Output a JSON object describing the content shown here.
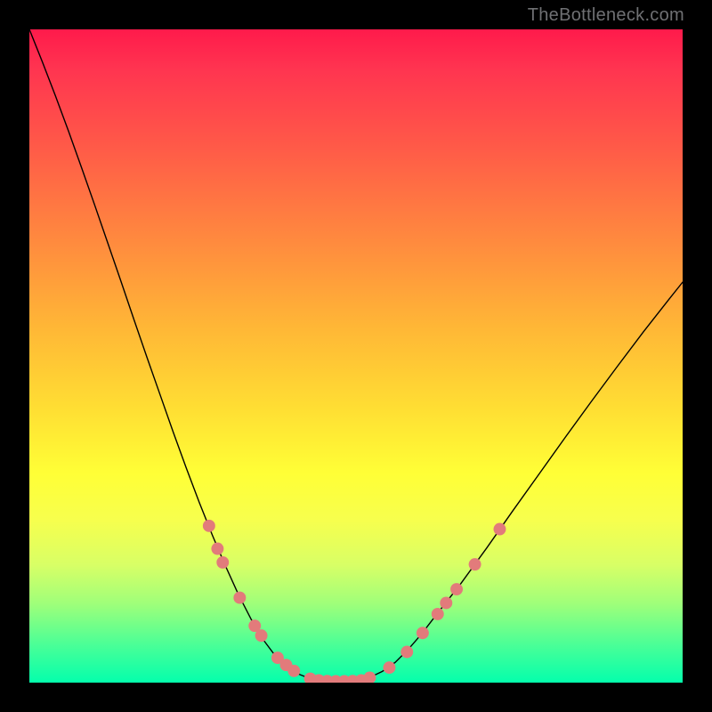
{
  "watermark": {
    "text": "TheBottleneck.com"
  },
  "chart_data": {
    "type": "line",
    "title": "",
    "xlabel": "",
    "ylabel": "",
    "xlim": [
      0,
      100
    ],
    "ylim": [
      0,
      100
    ],
    "grid": false,
    "series": [
      {
        "name": "curve-left",
        "stroke": "#000000",
        "stroke_width": 1.4,
        "x": [
          0,
          2,
          4,
          6,
          8,
          10,
          12,
          14,
          16,
          18,
          20,
          22,
          24,
          26,
          28,
          30,
          32,
          34,
          36,
          37.5,
          39,
          41,
          43
        ],
        "y": [
          100,
          95,
          89.8,
          84.4,
          78.8,
          73.1,
          67.3,
          61.5,
          55.6,
          49.8,
          44.1,
          38.4,
          32.9,
          27.6,
          22.6,
          17.9,
          13.5,
          9.6,
          6.3,
          4.3,
          2.9,
          1.4,
          0.6
        ]
      },
      {
        "name": "curve-flat",
        "stroke": "#000000",
        "stroke_width": 1.4,
        "x": [
          43,
          44,
          45,
          46,
          47,
          48,
          49,
          50,
          51,
          52
        ],
        "y": [
          0.6,
          0.35,
          0.25,
          0.2,
          0.2,
          0.2,
          0.25,
          0.35,
          0.5,
          0.75
        ]
      },
      {
        "name": "curve-right",
        "stroke": "#000000",
        "stroke_width": 1.4,
        "x": [
          52,
          54,
          56,
          58,
          60,
          62,
          66,
          70,
          74,
          78,
          82,
          86,
          90,
          94,
          98,
          100
        ],
        "y": [
          0.75,
          1.7,
          3.1,
          5.1,
          7.4,
          10.0,
          15.1,
          20.6,
          26.3,
          31.9,
          37.5,
          43.0,
          48.4,
          53.7,
          58.8,
          61.3
        ]
      }
    ],
    "markers": [
      {
        "cx": 27.5,
        "cy": 24.0,
        "r": 0.95,
        "fill": "#e27b7b"
      },
      {
        "cx": 28.8,
        "cy": 20.5,
        "r": 0.95,
        "fill": "#e27b7b"
      },
      {
        "cx": 29.6,
        "cy": 18.4,
        "r": 0.95,
        "fill": "#e27b7b"
      },
      {
        "cx": 32.2,
        "cy": 13.0,
        "r": 0.95,
        "fill": "#e27b7b"
      },
      {
        "cx": 34.5,
        "cy": 8.7,
        "r": 0.95,
        "fill": "#e27b7b"
      },
      {
        "cx": 35.5,
        "cy": 7.2,
        "r": 0.95,
        "fill": "#e27b7b"
      },
      {
        "cx": 38.0,
        "cy": 3.8,
        "r": 0.95,
        "fill": "#e27b7b"
      },
      {
        "cx": 39.3,
        "cy": 2.7,
        "r": 0.95,
        "fill": "#e27b7b"
      },
      {
        "cx": 40.5,
        "cy": 1.8,
        "r": 0.95,
        "fill": "#e27b7b"
      },
      {
        "cx": 43.0,
        "cy": 0.6,
        "r": 0.95,
        "fill": "#e27b7b"
      },
      {
        "cx": 44.3,
        "cy": 0.35,
        "r": 0.95,
        "fill": "#e27b7b"
      },
      {
        "cx": 45.6,
        "cy": 0.25,
        "r": 0.95,
        "fill": "#e27b7b"
      },
      {
        "cx": 46.9,
        "cy": 0.2,
        "r": 0.95,
        "fill": "#e27b7b"
      },
      {
        "cx": 48.2,
        "cy": 0.2,
        "r": 0.95,
        "fill": "#e27b7b"
      },
      {
        "cx": 49.5,
        "cy": 0.25,
        "r": 0.95,
        "fill": "#e27b7b"
      },
      {
        "cx": 50.8,
        "cy": 0.35,
        "r": 0.95,
        "fill": "#e27b7b"
      },
      {
        "cx": 52.1,
        "cy": 0.75,
        "r": 0.95,
        "fill": "#e27b7b"
      },
      {
        "cx": 55.1,
        "cy": 2.3,
        "r": 0.95,
        "fill": "#e27b7b"
      },
      {
        "cx": 57.8,
        "cy": 4.7,
        "r": 0.95,
        "fill": "#e27b7b"
      },
      {
        "cx": 60.2,
        "cy": 7.6,
        "r": 0.95,
        "fill": "#e27b7b"
      },
      {
        "cx": 62.5,
        "cy": 10.5,
        "r": 0.95,
        "fill": "#e27b7b"
      },
      {
        "cx": 63.8,
        "cy": 12.2,
        "r": 0.95,
        "fill": "#e27b7b"
      },
      {
        "cx": 65.4,
        "cy": 14.3,
        "r": 0.95,
        "fill": "#e27b7b"
      },
      {
        "cx": 68.2,
        "cy": 18.1,
        "r": 0.95,
        "fill": "#e27b7b"
      },
      {
        "cx": 72.0,
        "cy": 23.5,
        "r": 0.95,
        "fill": "#e27b7b"
      }
    ]
  }
}
